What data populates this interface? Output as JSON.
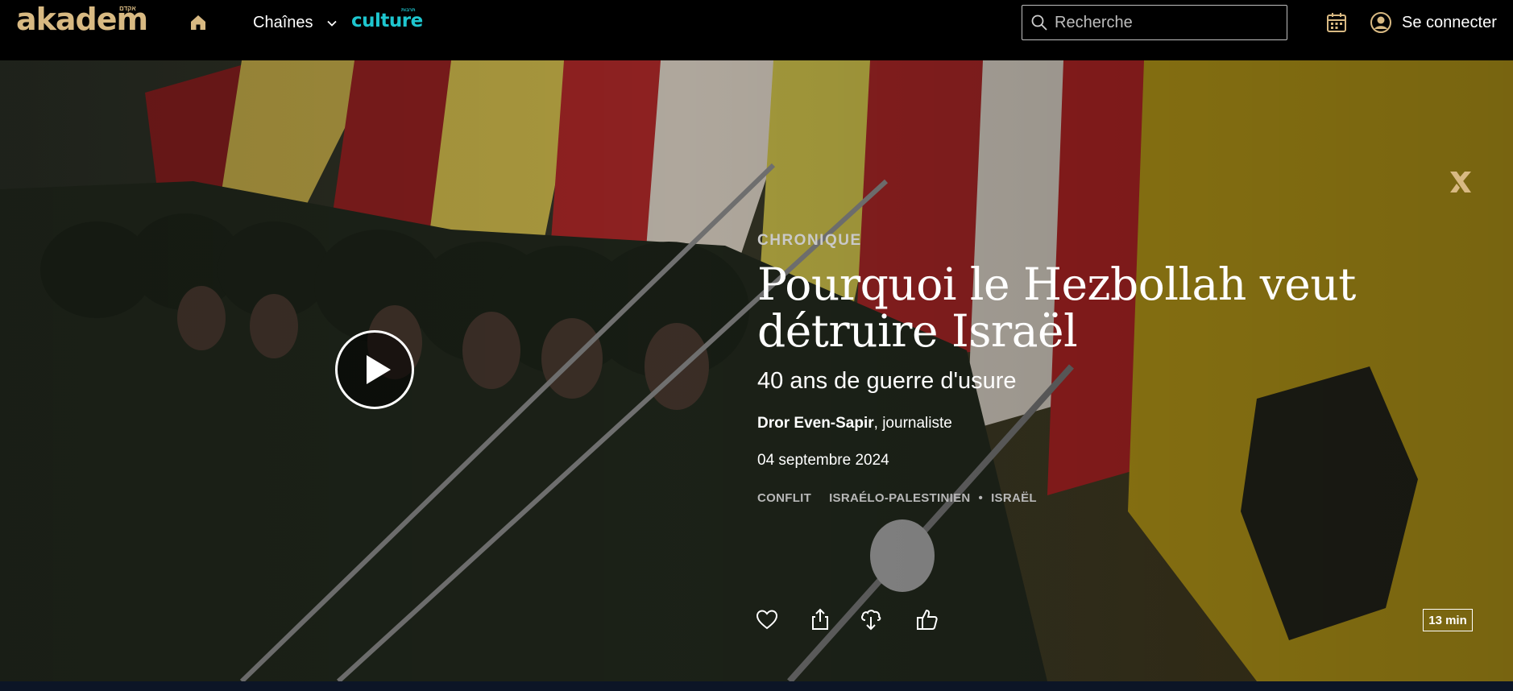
{
  "header": {
    "logo": "akadem",
    "logo_hebrew": "אקדם",
    "nav_chaines": "Chaînes",
    "culture_logo": "culture",
    "culture_hebrew": "תרבות",
    "search_placeholder": "Recherche",
    "login_label": "Se connecter"
  },
  "article": {
    "category": "CHRONIQUE",
    "title": "Pourquoi le Hezbollah veut détruire Israël",
    "subtitle": "40 ans de guerre d'usure",
    "author_name": "Dror Even-Sapir",
    "author_role": ", journaliste",
    "date": "04 septembre 2024",
    "tags": [
      "CONFLIT",
      "ISRAÉLO-PALESTINIEN",
      "ISRAËL"
    ],
    "duration": "13 min"
  },
  "icons": {
    "home": "home-icon",
    "chevron": "chevron-down-icon",
    "search": "search-icon",
    "calendar": "calendar-icon",
    "user": "user-icon",
    "play": "play-icon",
    "brand": "akadem-brand-icon",
    "like": "heart-icon",
    "share": "share-icon",
    "download": "download-icon",
    "thumbs": "thumbs-up-icon"
  },
  "colors": {
    "logo": "#d8b982",
    "culture": "#1ec6cf",
    "header_bg": "#000000"
  }
}
